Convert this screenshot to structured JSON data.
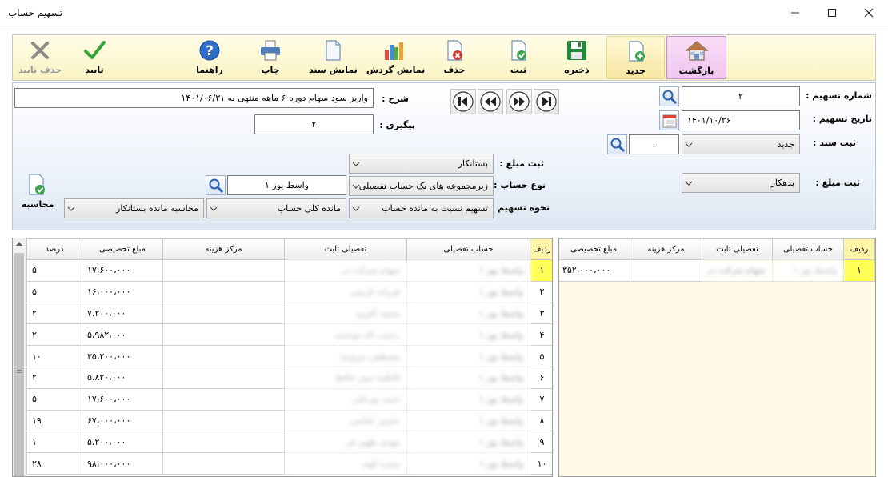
{
  "window": {
    "title": "تسهیم حساب"
  },
  "toolbar": {
    "buttons": [
      {
        "id": "back",
        "label": "بازگشت",
        "icon": "house-icon"
      },
      {
        "id": "new",
        "label": "جدید",
        "icon": "new-document-icon"
      },
      {
        "id": "save",
        "label": "ذخیره",
        "icon": "floppy-disk-icon"
      },
      {
        "id": "register",
        "label": "ثبت",
        "icon": "document-check-icon"
      },
      {
        "id": "delete",
        "label": "حذف",
        "icon": "document-delete-icon"
      },
      {
        "id": "show_turnover",
        "label": "نمایش گردش",
        "icon": "bar-chart-icon"
      },
      {
        "id": "show_document",
        "label": "نمایش سند",
        "icon": "document-icon"
      },
      {
        "id": "print",
        "label": "چاپ",
        "icon": "printer-icon"
      },
      {
        "id": "help",
        "label": "راهنما",
        "icon": "help-icon"
      },
      {
        "id": "confirm",
        "label": "تایید",
        "icon": "checkmark-icon"
      },
      {
        "id": "delete_confirm",
        "label": "حذف تایید",
        "icon": "x-mark-icon"
      }
    ]
  },
  "form": {
    "allocation_number_label": "شماره تسهیم :",
    "allocation_number": "۲",
    "allocation_date_label": "تاریخ تسهیم :",
    "allocation_date": "۱۴۰۱/۱۰/۲۶",
    "voucher_label": "ثبت سند :",
    "voucher_type": "جدید",
    "voucher_number": "۰",
    "amount_type_label": "ثبت مبلغ :",
    "amount_type_right": "بدهکار",
    "description_label": "شرح :",
    "description": "واریز سود سهام دوره ۶ ماهه منتهی به ۱۴۰۱/۰۶/۳۱",
    "followup_label": "پیگیری :",
    "followup": "۲",
    "amount_type_left_label": "ثبت مبلغ :",
    "amount_type_left": "بستانکار",
    "account_type_label": "نوع حساب :",
    "account_type": "زیرمجموعه های یک حساب تفصیلی",
    "account_value": "واسط یوز ۱",
    "method_label": "نحوه تسهیم :",
    "method": "تسهیم نسبت به مانده حساب",
    "method_2": "مانده کلی حساب",
    "method_3": "محاسبه مانده بستانکار",
    "calculate_label": "محاسبه"
  },
  "right_grid": {
    "headers": {
      "row": "ردیف",
      "detail": "حساب تفصیلی",
      "fixed": "تفصیلی ثابت",
      "cost_center": "مرکز هزینه",
      "amount": "مبلغ تخصیصی"
    },
    "rows": [
      {
        "row": "۱",
        "detail": "واسط یوز ۱",
        "fixed": "سهام شرکت در",
        "cost_center": "",
        "amount": "۳۵۲،۰۰۰،۰۰۰"
      }
    ]
  },
  "left_grid": {
    "headers": {
      "row": "ردیف",
      "detail": "حساب تفصیلی",
      "fixed": "تفصیلی ثابت",
      "cost_center": "مرکز هزینه",
      "amount": "مبلغ تخصیصی",
      "percent": "درصد"
    },
    "rows": [
      {
        "row": "۱",
        "detail": "واسط یوز ۱",
        "fixed": "سهام شرکت در",
        "cost_center": "",
        "amount": "۱۷،۶۰۰،۰۰۰",
        "percent": "۵"
      },
      {
        "row": "۲",
        "detail": "واسط یوز ۱",
        "fixed": "فرزانه کریمی",
        "cost_center": "",
        "amount": "۱۶،۰۰۰،۰۰۰",
        "percent": "۵"
      },
      {
        "row": "۳",
        "detail": "واسط یوز ۱",
        "fixed": "محمد اکبری",
        "cost_center": "",
        "amount": "۷،۲۰۰،۰۰۰",
        "percent": "۲"
      },
      {
        "row": "۴",
        "detail": "واسط یوز ۱",
        "fixed": "رحمت اله موحدی",
        "cost_center": "",
        "amount": "۵،۹۸۲،۰۰۰",
        "percent": "۲"
      },
      {
        "row": "۵",
        "detail": "واسط یوز ۱",
        "fixed": "مصطفی نیرومند",
        "cost_center": "",
        "amount": "۳۵،۲۰۰،۰۰۰",
        "percent": "۱۰"
      },
      {
        "row": "۶",
        "detail": "واسط یوز ۱",
        "fixed": "فاطمه سیر حافظ",
        "cost_center": "",
        "amount": "۵،۸۲۰،۰۰۰",
        "percent": "۲"
      },
      {
        "row": "۷",
        "detail": "واسط یوز ۱",
        "fixed": "حمید نورعلی",
        "cost_center": "",
        "amount": "۱۷،۶۰۰،۰۰۰",
        "percent": "۵"
      },
      {
        "row": "۸",
        "detail": "واسط یوز ۱",
        "fixed": "حسین عباسی",
        "cost_center": "",
        "amount": "۶۷،۰۰۰،۰۰۰",
        "percent": "۱۹"
      },
      {
        "row": "۹",
        "detail": "واسط یوز ۱",
        "fixed": "مهدی ظهیر فر",
        "cost_center": "",
        "amount": "۵،۲۰۰،۰۰۰",
        "percent": "۱"
      },
      {
        "row": "۱۰",
        "detail": "واسط یوز ۱",
        "fixed": "منیژه کهنه",
        "cost_center": "",
        "amount": "۹۸،۰۰۰،۰۰۰",
        "percent": "۲۸"
      }
    ]
  }
}
